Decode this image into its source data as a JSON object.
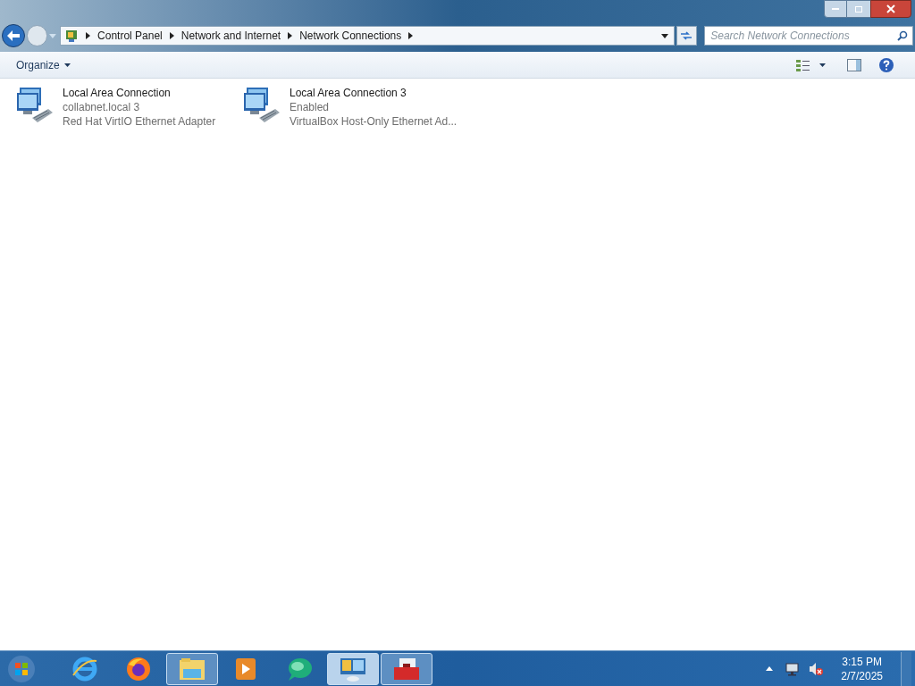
{
  "breadcrumbs": [
    "Control Panel",
    "Network and Internet",
    "Network Connections"
  ],
  "search": {
    "placeholder": "Search Network Connections"
  },
  "toolbar": {
    "organize": "Organize"
  },
  "connections": [
    {
      "name": "Local Area Connection",
      "status": "collabnet.local  3",
      "adapter": "Red Hat VirtIO Ethernet Adapter"
    },
    {
      "name": "Local Area Connection 3",
      "status": "Enabled",
      "adapter": "VirtualBox Host-Only Ethernet Ad..."
    }
  ],
  "taskbar": [
    {
      "kind": "ie",
      "open": false,
      "selected": false
    },
    {
      "kind": "firefox",
      "open": false,
      "selected": false
    },
    {
      "kind": "folder",
      "open": true,
      "selected": false
    },
    {
      "kind": "media",
      "open": false,
      "selected": false
    },
    {
      "kind": "chat",
      "open": false,
      "selected": false
    },
    {
      "kind": "network",
      "open": true,
      "selected": true
    },
    {
      "kind": "toolbox",
      "open": true,
      "selected": false
    }
  ],
  "clock": {
    "time": "3:15 PM",
    "date": "2/7/2025"
  }
}
